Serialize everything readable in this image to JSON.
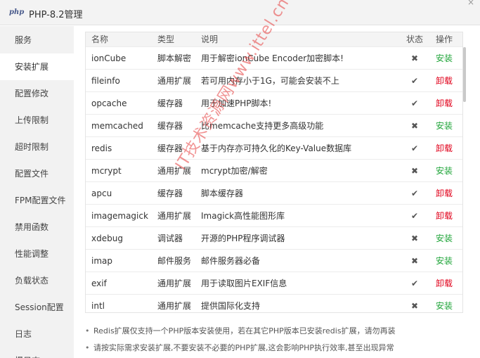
{
  "window": {
    "logo_text": "php",
    "title": "PHP-8.2管理",
    "close_glyph": "×"
  },
  "colors": {
    "install": "#20a53a",
    "uninstall": "#e0001a"
  },
  "sidebar": {
    "items": [
      {
        "label": "服务"
      },
      {
        "label": "安装扩展",
        "active": true
      },
      {
        "label": "配置修改"
      },
      {
        "label": "上传限制"
      },
      {
        "label": "超时限制"
      },
      {
        "label": "配置文件"
      },
      {
        "label": "FPM配置文件"
      },
      {
        "label": "禁用函数"
      },
      {
        "label": "性能调整"
      },
      {
        "label": "负载状态"
      },
      {
        "label": "Session配置"
      },
      {
        "label": "日志"
      },
      {
        "label": "慢日志"
      }
    ]
  },
  "table": {
    "headers": {
      "name": "名称",
      "type": "类型",
      "desc": "说明",
      "status": "状态",
      "op": "操作"
    },
    "rows": [
      {
        "name": "ionCube",
        "type": "脚本解密",
        "desc": "用于解密ionCube Encoder加密脚本!",
        "status": "✖",
        "installed": false,
        "op": "安装"
      },
      {
        "name": "fileinfo",
        "type": "通用扩展",
        "desc": "若可用内存小于1G，可能会安装不上",
        "status": "✔",
        "installed": true,
        "op": "卸载"
      },
      {
        "name": "opcache",
        "type": "缓存器",
        "desc": "用于加速PHP脚本!",
        "status": "✔",
        "installed": true,
        "op": "卸载"
      },
      {
        "name": "memcached",
        "type": "缓存器",
        "desc": "比memcache支持更多高级功能",
        "status": "✖",
        "installed": false,
        "op": "安装"
      },
      {
        "name": "redis",
        "type": "缓存器",
        "desc": "基于内存亦可持久化的Key-Value数据库",
        "status": "✔",
        "installed": true,
        "op": "卸载"
      },
      {
        "name": "mcrypt",
        "type": "通用扩展",
        "desc": "mcrypt加密/解密",
        "status": "✖",
        "installed": false,
        "op": "安装"
      },
      {
        "name": "apcu",
        "type": "缓存器",
        "desc": "脚本缓存器",
        "status": "✔",
        "installed": true,
        "op": "卸载"
      },
      {
        "name": "imagemagick",
        "type": "通用扩展",
        "desc": "Imagick高性能图形库",
        "status": "✔",
        "installed": true,
        "op": "卸载"
      },
      {
        "name": "xdebug",
        "type": "调试器",
        "desc": "开源的PHP程序调试器",
        "status": "✖",
        "installed": false,
        "op": "安装"
      },
      {
        "name": "imap",
        "type": "邮件服务",
        "desc": "邮件服务器必备",
        "status": "✖",
        "installed": false,
        "op": "安装"
      },
      {
        "name": "exif",
        "type": "通用扩展",
        "desc": "用于读取图片EXIF信息",
        "status": "✔",
        "installed": true,
        "op": "卸载"
      },
      {
        "name": "intl",
        "type": "通用扩展",
        "desc": "提供国际化支持",
        "status": "✖",
        "installed": false,
        "op": "安装"
      }
    ]
  },
  "tips": [
    "Redis扩展仅支持一个PHP版本安装使用，若在其它PHP版本已安装redis扩展，请勿再装",
    "请按实际需求安装扩展,不要安装不必要的PHP扩展,这会影响PHP执行效率,甚至出现异常"
  ],
  "watermark": "IT技术资源网www.ittel.cn"
}
